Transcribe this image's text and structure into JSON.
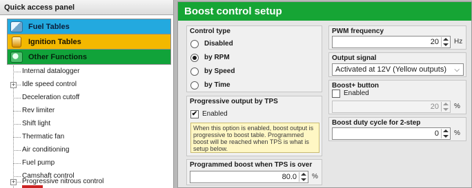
{
  "left_panel": {
    "title": "Quick access panel",
    "categories": [
      {
        "label": "Fuel Tables",
        "icon": "fuel-table-icon",
        "color": "#23a9df"
      },
      {
        "label": "Ignition Tables",
        "icon": "ignition-icon",
        "color": "#f3b800"
      },
      {
        "label": "Other Functions",
        "icon": "functions-icon",
        "color": "#11a33a"
      }
    ],
    "items": [
      {
        "label": "Internal datalogger",
        "expandable": false
      },
      {
        "label": "Idle speed control",
        "expandable": true
      },
      {
        "label": "Deceleration cutoff",
        "expandable": false
      },
      {
        "label": "Rev limiter",
        "expandable": false
      },
      {
        "label": "Shift light",
        "expandable": false
      },
      {
        "label": "Thermatic fan",
        "expandable": false
      },
      {
        "label": "Air conditioning",
        "expandable": false
      },
      {
        "label": "Fuel pump",
        "expandable": false
      },
      {
        "label": "Camshaft control",
        "expandable": false
      },
      {
        "label": "Progressive nitrous control",
        "expandable": true
      }
    ],
    "expander_symbol": "+"
  },
  "boost_panel": {
    "title": "Boost control setup",
    "title_color": "#16a535",
    "control_type": {
      "title": "Control type",
      "options": [
        {
          "label": "Disabled",
          "selected": false
        },
        {
          "label": "by RPM",
          "selected": true
        },
        {
          "label": "by Speed",
          "selected": false
        },
        {
          "label": "by Time",
          "selected": false
        }
      ]
    },
    "progressive_tps": {
      "title": "Progressive output by TPS",
      "enabled_label": "Enabled",
      "enabled": true,
      "check_mark": "✔",
      "note": "When this option is enabled, boost output is progressive to boost table. Programmed boost will be reached when TPS is what is setup below."
    },
    "programmed_boost": {
      "title": "Programmed boost when TPS is over",
      "value": "80.0",
      "unit": "%"
    },
    "pwm_frequency": {
      "title": "PWM frequency",
      "value": "20",
      "unit": "Hz"
    },
    "output_signal": {
      "title": "Output signal",
      "selected": "Activated at 12V (Yellow outputs)",
      "chevron": "⌵"
    },
    "boost_plus": {
      "title": "Boost+ button",
      "enabled_label": "Enabled",
      "enabled": false,
      "value": "20",
      "unit": "%"
    },
    "duty_2step": {
      "title": "Boost duty cycle for 2-step",
      "value": "0",
      "unit": "%"
    }
  }
}
